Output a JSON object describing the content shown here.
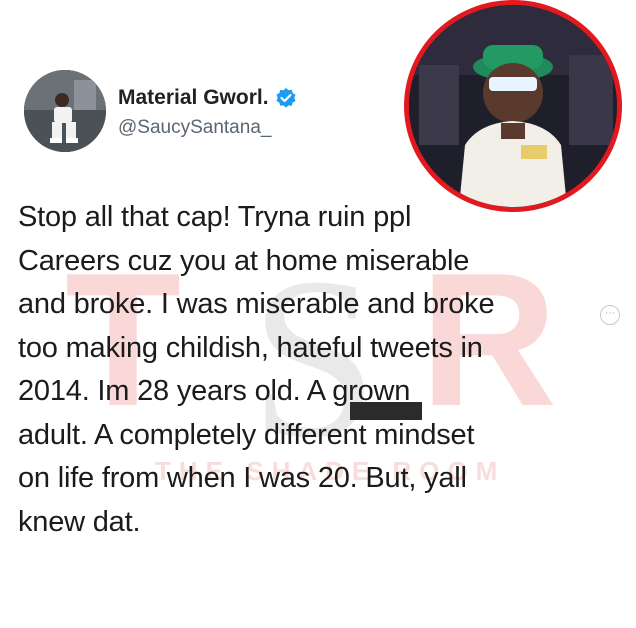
{
  "profile": {
    "display_name": "Material Gworl.",
    "handle": "@SaucySantana_"
  },
  "tweet": {
    "text": "Stop all that cap! Tryna ruin ppl\nCareers cuz you at home miserable\nand broke. I was miserable and broke\ntoo making childish, hateful tweets in\n2014. Im 28 years old. A grown\nadult. A completely different mindset\non life from when I was 20. But, yall\nknew dat."
  },
  "watermark": {
    "letters": "TSR",
    "tagline": "THE SHADE ROOM"
  },
  "colors": {
    "accent_red": "#e2191f",
    "verified_blue": "#1d9bf0",
    "watermark_red": "#f2a6a6"
  },
  "icons": {
    "verified": "verified-badge-icon",
    "more": "more-options-icon"
  }
}
